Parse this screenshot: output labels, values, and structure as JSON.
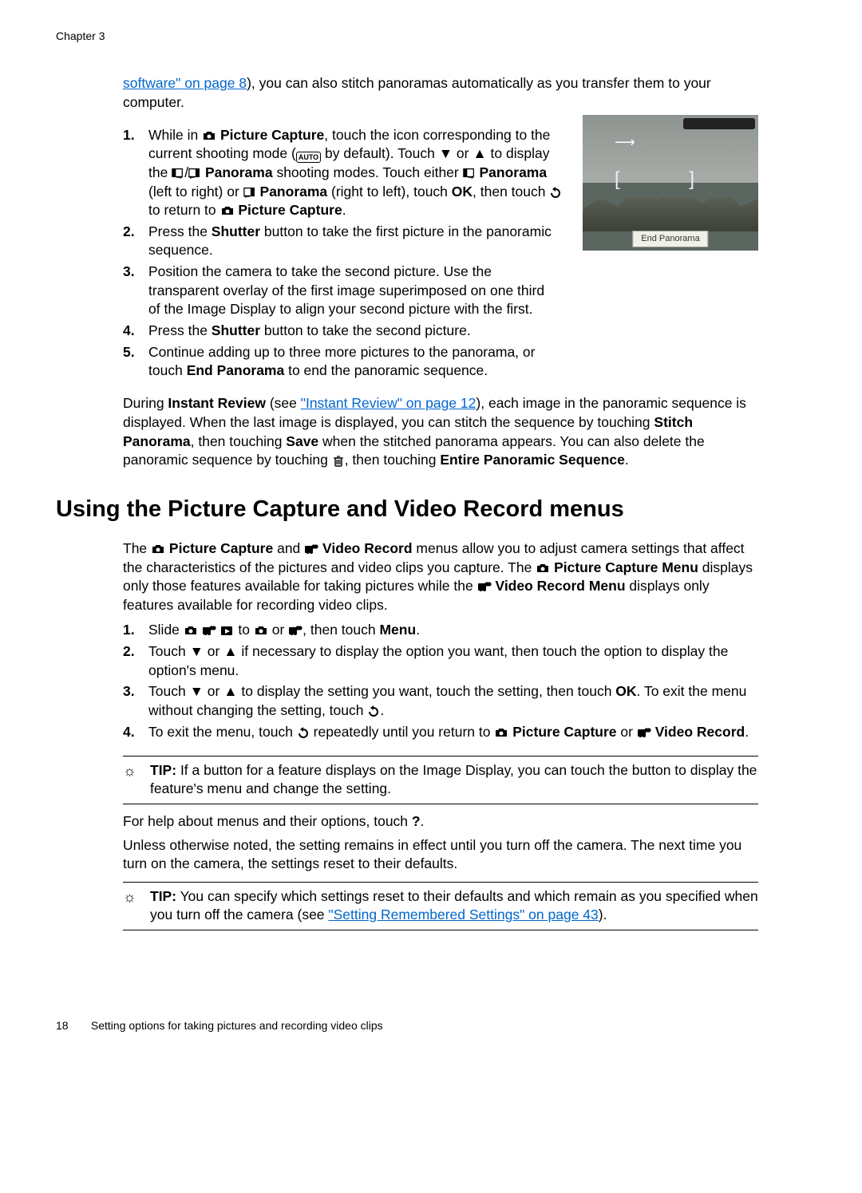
{
  "header": {
    "chapter": "Chapter 3"
  },
  "intro": {
    "link_text": "software\" on page 8",
    "rest": "), you can also stitch panoramas automatically as you transfer them to your computer."
  },
  "steps_a": {
    "s1": {
      "p1": "While in ",
      "b1": "Picture Capture",
      "p2": ", touch the icon corresponding to the current shooting mode (",
      "auto": "AUTO",
      "p3": " by default). Touch ",
      "p4": " or ",
      "p5": " to display the ",
      "b2": "Panorama",
      "p6": " shooting modes. Touch either ",
      "b3": "Panorama",
      "p7": " (left to right) or ",
      "b4": "Panorama",
      "p8": " (right to left), touch ",
      "b5": "OK",
      "p9": ", then touch ",
      "p10": " to return to ",
      "b6": "Picture Capture",
      "p11": "."
    },
    "s2": {
      "p1": "Press the ",
      "b1": "Shutter",
      "p2": " button to take the first picture in the panoramic sequence."
    },
    "s3": "Position the camera to take the second picture. Use the transparent overlay of the first image superimposed on one third of the Image Display to align your second picture with the first.",
    "s4": {
      "p1": "Press the ",
      "b1": "Shutter",
      "p2": " button to take the second picture."
    },
    "s5": {
      "p1": "Continue adding up to three more pictures to the panorama, or touch ",
      "b1": "End Panorama",
      "p2": " to end the panoramic sequence."
    }
  },
  "screenshot": {
    "end": "End Panorama"
  },
  "review_para": {
    "p1": "During ",
    "b1": "Instant Review",
    "p2": " (see ",
    "link": "\"Instant Review\" on page 12",
    "p3": "), each image in the panoramic sequence is displayed. When the last image is displayed, you can stitch the sequence by touching ",
    "b2": "Stitch Panorama",
    "p4": ", then touching ",
    "b3": "Save",
    "p5": " when the stitched panorama appears. You can also delete the panoramic sequence by touching ",
    "p6": ", then touching ",
    "b4": "Entire Panoramic Sequence",
    "p7": "."
  },
  "section_title": "Using the Picture Capture and Video Record menus",
  "menus_para": {
    "p1": "The ",
    "b1": "Picture Capture",
    "p2": " and ",
    "b2": "Video Record",
    "p3": " menus allow you to adjust camera settings that affect the characteristics of the pictures and video clips you capture. The ",
    "b3": "Picture Capture Menu",
    "p4": " displays only those features available for taking pictures while the ",
    "b4": "Video Record Menu",
    "p5": " displays only features available for recording video clips."
  },
  "steps_b": {
    "s1": {
      "p1": "Slide ",
      "p2": " to ",
      "p3": " or ",
      "p4": ", then touch ",
      "b1": "Menu",
      "p5": "."
    },
    "s2": {
      "p1": "Touch ",
      "p2": " or ",
      "p3": " if necessary to display the option you want, then touch the option to display the option's menu."
    },
    "s3": {
      "p1": "Touch ",
      "p2": " or ",
      "p3": " to display the setting you want, touch the setting, then touch ",
      "b1": "OK",
      "p4": ". To exit the menu without changing the setting, touch ",
      "p5": "."
    },
    "s4": {
      "p1": "To exit the menu, touch ",
      "p2": " repeatedly until you return to ",
      "b1": "Picture Capture",
      "p3": " or ",
      "b2": "Video Record",
      "p4": "."
    }
  },
  "tip1": {
    "label": "TIP:",
    "text": "If a button for a feature displays on the Image Display, you can touch the button to display the feature's menu and change the setting."
  },
  "help_line": {
    "p1": "For help about menus and their options, touch ",
    "p2": "."
  },
  "reset_line": "Unless otherwise noted, the setting remains in effect until you turn off the camera. The next time you turn on the camera, the settings reset to their defaults.",
  "tip2": {
    "label": "TIP:",
    "p1": "You can specify which settings reset to their defaults and which remain as you specified when you turn off the camera (see ",
    "link": "\"Setting Remembered Settings\" on page 43",
    "p2": ")."
  },
  "footer": {
    "page": "18",
    "title": "Setting options for taking pictures and recording video clips"
  }
}
